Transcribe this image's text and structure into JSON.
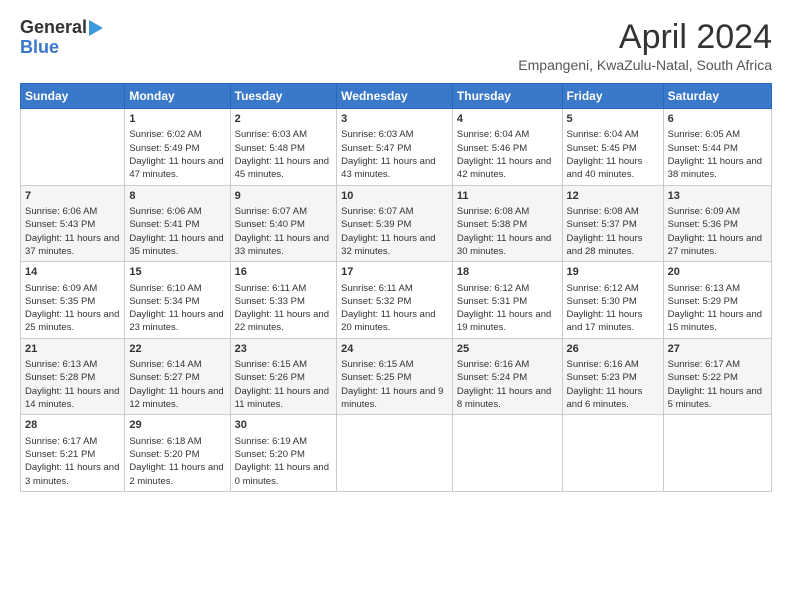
{
  "header": {
    "logo_line1": "General",
    "logo_line2": "Blue",
    "title": "April 2024",
    "subtitle": "Empangeni, KwaZulu-Natal, South Africa"
  },
  "weekdays": [
    "Sunday",
    "Monday",
    "Tuesday",
    "Wednesday",
    "Thursday",
    "Friday",
    "Saturday"
  ],
  "weeks": [
    [
      {
        "day": "",
        "sunrise": "",
        "sunset": "",
        "daylight": ""
      },
      {
        "day": "1",
        "sunrise": "Sunrise: 6:02 AM",
        "sunset": "Sunset: 5:49 PM",
        "daylight": "Daylight: 11 hours and 47 minutes."
      },
      {
        "day": "2",
        "sunrise": "Sunrise: 6:03 AM",
        "sunset": "Sunset: 5:48 PM",
        "daylight": "Daylight: 11 hours and 45 minutes."
      },
      {
        "day": "3",
        "sunrise": "Sunrise: 6:03 AM",
        "sunset": "Sunset: 5:47 PM",
        "daylight": "Daylight: 11 hours and 43 minutes."
      },
      {
        "day": "4",
        "sunrise": "Sunrise: 6:04 AM",
        "sunset": "Sunset: 5:46 PM",
        "daylight": "Daylight: 11 hours and 42 minutes."
      },
      {
        "day": "5",
        "sunrise": "Sunrise: 6:04 AM",
        "sunset": "Sunset: 5:45 PM",
        "daylight": "Daylight: 11 hours and 40 minutes."
      },
      {
        "day": "6",
        "sunrise": "Sunrise: 6:05 AM",
        "sunset": "Sunset: 5:44 PM",
        "daylight": "Daylight: 11 hours and 38 minutes."
      }
    ],
    [
      {
        "day": "7",
        "sunrise": "Sunrise: 6:06 AM",
        "sunset": "Sunset: 5:43 PM",
        "daylight": "Daylight: 11 hours and 37 minutes."
      },
      {
        "day": "8",
        "sunrise": "Sunrise: 6:06 AM",
        "sunset": "Sunset: 5:41 PM",
        "daylight": "Daylight: 11 hours and 35 minutes."
      },
      {
        "day": "9",
        "sunrise": "Sunrise: 6:07 AM",
        "sunset": "Sunset: 5:40 PM",
        "daylight": "Daylight: 11 hours and 33 minutes."
      },
      {
        "day": "10",
        "sunrise": "Sunrise: 6:07 AM",
        "sunset": "Sunset: 5:39 PM",
        "daylight": "Daylight: 11 hours and 32 minutes."
      },
      {
        "day": "11",
        "sunrise": "Sunrise: 6:08 AM",
        "sunset": "Sunset: 5:38 PM",
        "daylight": "Daylight: 11 hours and 30 minutes."
      },
      {
        "day": "12",
        "sunrise": "Sunrise: 6:08 AM",
        "sunset": "Sunset: 5:37 PM",
        "daylight": "Daylight: 11 hours and 28 minutes."
      },
      {
        "day": "13",
        "sunrise": "Sunrise: 6:09 AM",
        "sunset": "Sunset: 5:36 PM",
        "daylight": "Daylight: 11 hours and 27 minutes."
      }
    ],
    [
      {
        "day": "14",
        "sunrise": "Sunrise: 6:09 AM",
        "sunset": "Sunset: 5:35 PM",
        "daylight": "Daylight: 11 hours and 25 minutes."
      },
      {
        "day": "15",
        "sunrise": "Sunrise: 6:10 AM",
        "sunset": "Sunset: 5:34 PM",
        "daylight": "Daylight: 11 hours and 23 minutes."
      },
      {
        "day": "16",
        "sunrise": "Sunrise: 6:11 AM",
        "sunset": "Sunset: 5:33 PM",
        "daylight": "Daylight: 11 hours and 22 minutes."
      },
      {
        "day": "17",
        "sunrise": "Sunrise: 6:11 AM",
        "sunset": "Sunset: 5:32 PM",
        "daylight": "Daylight: 11 hours and 20 minutes."
      },
      {
        "day": "18",
        "sunrise": "Sunrise: 6:12 AM",
        "sunset": "Sunset: 5:31 PM",
        "daylight": "Daylight: 11 hours and 19 minutes."
      },
      {
        "day": "19",
        "sunrise": "Sunrise: 6:12 AM",
        "sunset": "Sunset: 5:30 PM",
        "daylight": "Daylight: 11 hours and 17 minutes."
      },
      {
        "day": "20",
        "sunrise": "Sunrise: 6:13 AM",
        "sunset": "Sunset: 5:29 PM",
        "daylight": "Daylight: 11 hours and 15 minutes."
      }
    ],
    [
      {
        "day": "21",
        "sunrise": "Sunrise: 6:13 AM",
        "sunset": "Sunset: 5:28 PM",
        "daylight": "Daylight: 11 hours and 14 minutes."
      },
      {
        "day": "22",
        "sunrise": "Sunrise: 6:14 AM",
        "sunset": "Sunset: 5:27 PM",
        "daylight": "Daylight: 11 hours and 12 minutes."
      },
      {
        "day": "23",
        "sunrise": "Sunrise: 6:15 AM",
        "sunset": "Sunset: 5:26 PM",
        "daylight": "Daylight: 11 hours and 11 minutes."
      },
      {
        "day": "24",
        "sunrise": "Sunrise: 6:15 AM",
        "sunset": "Sunset: 5:25 PM",
        "daylight": "Daylight: 11 hours and 9 minutes."
      },
      {
        "day": "25",
        "sunrise": "Sunrise: 6:16 AM",
        "sunset": "Sunset: 5:24 PM",
        "daylight": "Daylight: 11 hours and 8 minutes."
      },
      {
        "day": "26",
        "sunrise": "Sunrise: 6:16 AM",
        "sunset": "Sunset: 5:23 PM",
        "daylight": "Daylight: 11 hours and 6 minutes."
      },
      {
        "day": "27",
        "sunrise": "Sunrise: 6:17 AM",
        "sunset": "Sunset: 5:22 PM",
        "daylight": "Daylight: 11 hours and 5 minutes."
      }
    ],
    [
      {
        "day": "28",
        "sunrise": "Sunrise: 6:17 AM",
        "sunset": "Sunset: 5:21 PM",
        "daylight": "Daylight: 11 hours and 3 minutes."
      },
      {
        "day": "29",
        "sunrise": "Sunrise: 6:18 AM",
        "sunset": "Sunset: 5:20 PM",
        "daylight": "Daylight: 11 hours and 2 minutes."
      },
      {
        "day": "30",
        "sunrise": "Sunrise: 6:19 AM",
        "sunset": "Sunset: 5:20 PM",
        "daylight": "Daylight: 11 hours and 0 minutes."
      },
      {
        "day": "",
        "sunrise": "",
        "sunset": "",
        "daylight": ""
      },
      {
        "day": "",
        "sunrise": "",
        "sunset": "",
        "daylight": ""
      },
      {
        "day": "",
        "sunrise": "",
        "sunset": "",
        "daylight": ""
      },
      {
        "day": "",
        "sunrise": "",
        "sunset": "",
        "daylight": ""
      }
    ]
  ]
}
